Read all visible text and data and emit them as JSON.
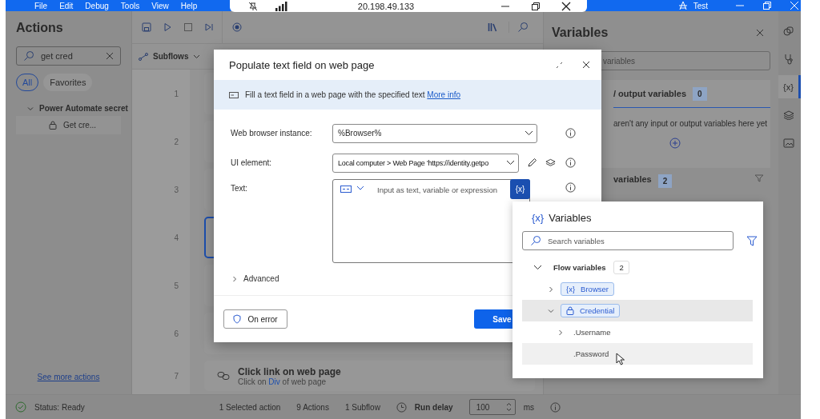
{
  "title_bar": {
    "menu": [
      "File",
      "Edit",
      "Debug",
      "Tools",
      "View",
      "Help"
    ],
    "user": "Test"
  },
  "remote_bar": {
    "address": "20.198.49.133"
  },
  "actions_panel": {
    "title": "Actions",
    "search": "get cred",
    "filters": [
      {
        "label": "All",
        "selected": true
      },
      {
        "label": "Favorites",
        "selected": false
      }
    ],
    "tree": [
      {
        "label": "Power Automate secret",
        "expanded": true,
        "children": [
          {
            "label": "Get cre..."
          }
        ]
      }
    ],
    "more_link": "See more actions"
  },
  "editor": {
    "subflows": "Subflows",
    "steps": [
      {
        "number": "1",
        "selected": false
      },
      {
        "number": "2",
        "selected": false
      },
      {
        "number": "3",
        "selected": false
      },
      {
        "number": "4",
        "selected": true
      },
      {
        "number": "5",
        "selected": false
      },
      {
        "number": "6",
        "selected": false
      },
      {
        "number": "7",
        "selected": false,
        "title": "Click link on web page",
        "description": [
          "Click on",
          "Div",
          "of web page"
        ]
      }
    ]
  },
  "variables_panel": {
    "title": "Variables",
    "search_placeholder": "variables",
    "sections": [
      {
        "title": "/ output variables",
        "count": "0",
        "empty_message": "aren't any input or output variables here yet"
      },
      {
        "title": "variables",
        "count": "2"
      }
    ]
  },
  "rail": [
    {
      "kind": "copilot",
      "selected": false
    },
    {
      "kind": "stethoscope",
      "selected": false
    },
    {
      "kind": "variables",
      "label": "{x}",
      "selected": true
    },
    {
      "kind": "layers",
      "selected": false
    },
    {
      "kind": "image",
      "selected": false
    }
  ],
  "dialog": {
    "title": "Populate text field on web page",
    "description": "Fill a text field in a web page with the specified text",
    "link": "More info",
    "fields": [
      {
        "kind": "dropdown",
        "label": "Web browser instance:",
        "value": "%Browser%"
      },
      {
        "kind": "element",
        "label": "UI element:",
        "value": "Local computer > Web Page 'https://identity.getpo"
      },
      {
        "kind": "text",
        "label": "Text:",
        "placeholder": "Input as text, variable or expression",
        "button": "{x}"
      }
    ],
    "advanced": "Advanced",
    "on_error": "On error",
    "save": "Save"
  },
  "variable_picker": {
    "icon_text": "{x}",
    "title": "Variables",
    "search_placeholder": "Search variables",
    "groups": [
      {
        "label": "Flow variables",
        "count": "2",
        "expanded": true,
        "children": [
          {
            "label": "Browser",
            "kind": "variable",
            "icon_text": "{x}",
            "expandable": true,
            "expanded": false,
            "selected": false
          },
          {
            "label": "Credential",
            "kind": "credential",
            "expandable": true,
            "expanded": true,
            "selected": true,
            "children": [
              {
                "label": ".Username",
                "expandable": true,
                "expanded": false,
                "hovered": false
              },
              {
                "label": ".Password",
                "expandable": false,
                "hovered": true
              }
            ]
          }
        ]
      }
    ]
  },
  "status_bar": {
    "status": "Status: Ready",
    "selection": "1 Selected action",
    "actions": "9 Actions",
    "subflows": "1 Subflow",
    "run_delay_label": "Run delay",
    "run_delay": "100",
    "unit": "ms"
  }
}
